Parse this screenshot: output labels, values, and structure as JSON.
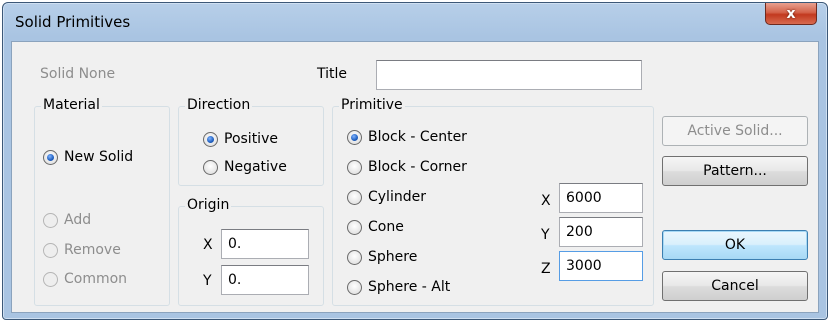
{
  "window": {
    "title": "Solid Primitives",
    "close_glyph": "x"
  },
  "header": {
    "solid_label": "Solid None",
    "title_label": "Title",
    "title_value": ""
  },
  "material": {
    "legend": "Material",
    "options": [
      {
        "label": "New Solid",
        "checked": true,
        "enabled": true
      },
      {
        "label": "Add",
        "checked": false,
        "enabled": false
      },
      {
        "label": "Remove",
        "checked": false,
        "enabled": false
      },
      {
        "label": "Common",
        "checked": false,
        "enabled": false
      }
    ]
  },
  "direction": {
    "legend": "Direction",
    "options": [
      {
        "label": "Positive",
        "checked": true
      },
      {
        "label": "Negative",
        "checked": false
      }
    ]
  },
  "origin": {
    "legend": "Origin",
    "x_label": "X",
    "x_value": "0.",
    "y_label": "Y",
    "y_value": "0."
  },
  "primitive": {
    "legend": "Primitive",
    "options": [
      {
        "label": "Block - Center",
        "checked": true
      },
      {
        "label": "Block - Corner",
        "checked": false
      },
      {
        "label": "Cylinder",
        "checked": false
      },
      {
        "label": "Cone",
        "checked": false
      },
      {
        "label": "Sphere",
        "checked": false
      },
      {
        "label": "Sphere - Alt",
        "checked": false
      }
    ],
    "dims": {
      "x_label": "X",
      "x_value": "6000",
      "y_label": "Y",
      "y_value": "200",
      "z_label": "Z",
      "z_value": "3000"
    }
  },
  "buttons": {
    "active_solid": "Active Solid...",
    "pattern": "Pattern...",
    "ok": "OK",
    "cancel": "Cancel"
  }
}
